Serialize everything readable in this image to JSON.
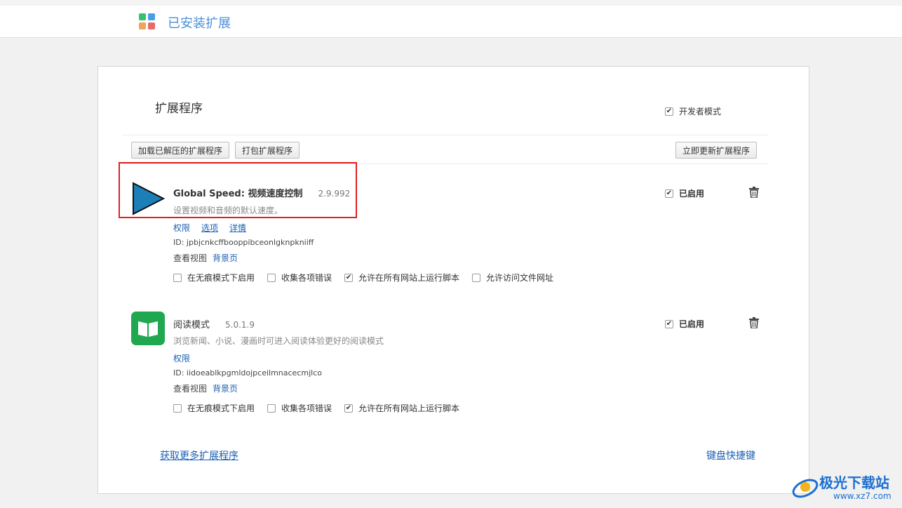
{
  "header": {
    "title": "已安装扩展"
  },
  "page": {
    "heading": "扩展程序",
    "developer_mode_label": "开发者模式",
    "developer_mode_checked": true,
    "buttons": {
      "load_unpacked": "加载已解压的扩展程序",
      "pack": "打包扩展程序",
      "update_now": "立即更新扩展程序"
    }
  },
  "extensions": [
    {
      "name": "Global Speed: 视频速度控制",
      "version": "2.9.992",
      "description": "设置视频和音频的默认速度。",
      "links": [
        "权限",
        "选项",
        "详情"
      ],
      "id_text": "ID: jpbjcnkcffbooppibceonlgknpkniiff",
      "views_label": "查看视图",
      "views_link": "背景页",
      "enabled_label": "已启用",
      "options": [
        {
          "label": "在无痕模式下启用",
          "checked": false
        },
        {
          "label": "收集各项错误",
          "checked": false
        },
        {
          "label": "允许在所有网站上运行脚本",
          "checked": true
        },
        {
          "label": "允许访问文件网址",
          "checked": false
        }
      ]
    },
    {
      "name": "阅读模式",
      "version": "5.0.1.9",
      "description": "浏览新闻、小说、漫画时可进入阅读体验更好的阅读模式",
      "links": [
        "权限"
      ],
      "id_text": "ID: iidoeablkpgmldojpceilmnacecmjlco",
      "views_label": "查看视图",
      "views_link": "背景页",
      "enabled_label": "已启用",
      "options": [
        {
          "label": "在无痕模式下启用",
          "checked": false
        },
        {
          "label": "收集各项错误",
          "checked": false
        },
        {
          "label": "允许在所有网站上运行脚本",
          "checked": true
        }
      ]
    }
  ],
  "footer": {
    "get_more": "获取更多扩展程序",
    "shortcuts": "键盘快捷键"
  },
  "watermark": {
    "title": "极光下载站",
    "url": "www.xz7.com"
  },
  "colors": {
    "accent": "#4a90d9",
    "link": "#1a5fb4",
    "highlight": "#e02020",
    "play_icon": "#1c7fb8",
    "reader_icon": "#1fa84f"
  }
}
